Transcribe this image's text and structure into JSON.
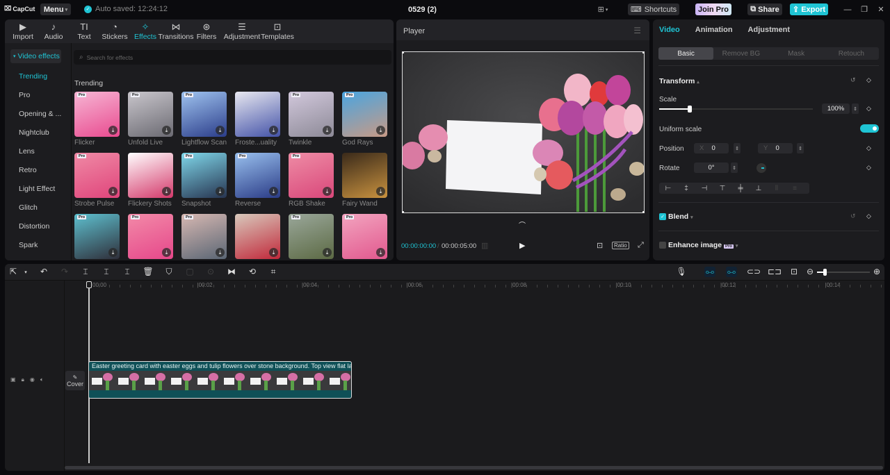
{
  "app": {
    "brand": "CapCut",
    "menu_label": "Menu",
    "autosave": "Auto saved: 12:24:12",
    "project_title": "0529 (2)"
  },
  "titlebar": {
    "shortcuts": "Shortcuts",
    "join_pro": "Join Pro",
    "share": "Share",
    "export": "Export"
  },
  "media_tabs": [
    {
      "label": "Import",
      "icon": "▶"
    },
    {
      "label": "Audio",
      "icon": "♪"
    },
    {
      "label": "Text",
      "icon": "TI"
    },
    {
      "label": "Stickers",
      "icon": "◔"
    },
    {
      "label": "Effects",
      "icon": "✧",
      "active": true
    },
    {
      "label": "Transitions",
      "icon": "⋈"
    },
    {
      "label": "Filters",
      "icon": "⊛"
    },
    {
      "label": "Adjustment",
      "icon": "☰"
    },
    {
      "label": "Templates",
      "icon": "⊡"
    }
  ],
  "effects_sidebar": {
    "header": "Video effects",
    "items": [
      "Trending",
      "Pro",
      "Opening & ...",
      "Nightclub",
      "Lens",
      "Retro",
      "Light Effect",
      "Glitch",
      "Distortion",
      "Spark"
    ],
    "active": "Trending"
  },
  "search": {
    "placeholder": "Search for effects"
  },
  "effects_section": "Trending",
  "effects": [
    {
      "name": "Flicker",
      "pro": true,
      "colors": [
        "#f6b6d4",
        "#e94a8f"
      ]
    },
    {
      "name": "Unfold Live",
      "pro": true,
      "colors": [
        "#c9c6cc",
        "#6b6a72"
      ]
    },
    {
      "name": "Lightflow Scan",
      "pro": true,
      "colors": [
        "#9fc3ef",
        "#2b3d8a"
      ]
    },
    {
      "name": "Froste...uality",
      "pro": false,
      "colors": [
        "#e8e8f0",
        "#4352a8"
      ]
    },
    {
      "name": "Twinkle",
      "pro": true,
      "colors": [
        "#d2c8dc",
        "#8d8a97"
      ]
    },
    {
      "name": "God Rays",
      "pro": true,
      "colors": [
        "#4aa5e0",
        "#c79a86"
      ]
    },
    {
      "name": "Strobe Pulse",
      "pro": true,
      "colors": [
        "#ef8aa5",
        "#e0447b"
      ]
    },
    {
      "name": "Flickery Shots",
      "pro": false,
      "colors": [
        "#ffffff",
        "#d4386a"
      ]
    },
    {
      "name": "Snapshot",
      "pro": true,
      "colors": [
        "#7fd7ea",
        "#273450"
      ]
    },
    {
      "name": "Reverse",
      "pro": true,
      "colors": [
        "#99c0ee",
        "#2a3b86"
      ]
    },
    {
      "name": "RGB Shake",
      "pro": true,
      "colors": [
        "#ee8ca5",
        "#d9477a"
      ]
    },
    {
      "name": "Fairy Wand",
      "pro": false,
      "colors": [
        "#3a2a1a",
        "#c9923f"
      ]
    },
    {
      "name": "",
      "pro": true,
      "colors": [
        "#5ec0cf",
        "#2f2f3a"
      ]
    },
    {
      "name": "",
      "pro": true,
      "colors": [
        "#f28aa8",
        "#e6478a"
      ]
    },
    {
      "name": "",
      "pro": true,
      "colors": [
        "#d7b8b2",
        "#5a6674"
      ]
    },
    {
      "name": "",
      "pro": false,
      "colors": [
        "#d8c9bc",
        "#c1283a"
      ]
    },
    {
      "name": "",
      "pro": true,
      "colors": [
        "#9aa79a",
        "#5c6a44"
      ]
    },
    {
      "name": "",
      "pro": true,
      "colors": [
        "#f2a4bf",
        "#e2588e"
      ]
    }
  ],
  "player": {
    "title": "Player",
    "current_time": "00:00:00:00",
    "duration": "00:00:05:00",
    "ratio_label": "Ratio"
  },
  "right_panel": {
    "tabs": [
      {
        "label": "Video",
        "active": true
      },
      {
        "label": "Animation"
      },
      {
        "label": "Adjustment"
      }
    ],
    "subtabs": [
      {
        "label": "Basic",
        "active": true
      },
      {
        "label": "Remove BG"
      },
      {
        "label": "Mask"
      },
      {
        "label": "Retouch"
      }
    ],
    "transform_label": "Transform",
    "scale_label": "Scale",
    "scale_value": "100%",
    "scale_fraction": 0.2,
    "uniform_scale_label": "Uniform scale",
    "uniform_scale_on": true,
    "position_label": "Position",
    "position_x_label": "X",
    "position_x": "0",
    "position_y_label": "Y",
    "position_y": "0",
    "rotate_label": "Rotate",
    "rotate_value": "0°",
    "blend_label": "Blend",
    "blend_checked": true,
    "enhance_label": "Enhance image",
    "enhance_badge": "Pro",
    "enhance_checked": false
  },
  "timeline": {
    "ruler": [
      "00:00",
      "|00:02",
      "|00:04",
      "|00:06",
      "|00:08",
      "|00:10",
      "|00:12",
      "|00:14"
    ],
    "cover_label": "Cover",
    "clip_title": "Easter greeting card with easter eggs and tulip flowers over stone background. Top view flat la",
    "zoom_fraction": 0.15
  },
  "colors": {
    "accent": "#1fc4d4",
    "panel": "#1c1c1f",
    "background": "#0b0b0e",
    "clip": "#0f5057"
  }
}
